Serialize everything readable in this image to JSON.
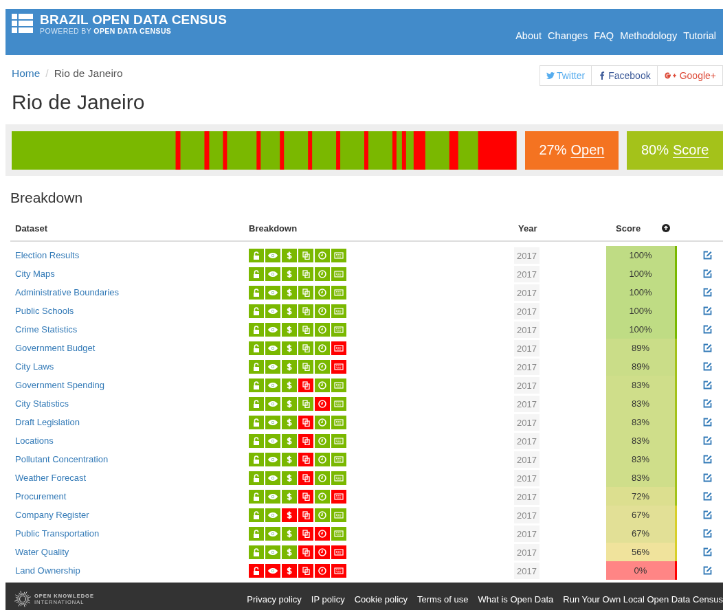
{
  "header": {
    "title": "BRAZIL OPEN DATA CENSUS",
    "subtitle_prefix": "POWERED BY",
    "subtitle_brand": "OPEN DATA CENSUS",
    "nav": [
      "About",
      "Changes",
      "FAQ",
      "Methodology",
      "Tutorial"
    ]
  },
  "breadcrumb": [
    {
      "label": "Home",
      "kind": "link"
    },
    {
      "label": "/",
      "kind": "separator"
    },
    {
      "label": "Rio de Janeiro",
      "kind": "current"
    }
  ],
  "share": [
    {
      "label": "Twitter",
      "kind": "twitter"
    },
    {
      "label": "Facebook",
      "kind": "facebook"
    },
    {
      "label": "Google+",
      "kind": "google"
    }
  ],
  "page_title": "Rio de Janeiro",
  "summary": [
    {
      "value": "27%",
      "label": "Open",
      "kind": "open"
    },
    {
      "value": "80%",
      "label": "Score",
      "kind": "score"
    }
  ],
  "section_title": "Breakdown",
  "table": {
    "columns": [
      "Dataset",
      "Breakdown",
      "Year",
      "Score"
    ],
    "rows": [
      {
        "name": "Election Results",
        "checks": [
          true,
          true,
          true,
          true,
          true,
          true
        ],
        "year": "2017",
        "score": "100%",
        "color": "#bfdc84"
      },
      {
        "name": "City Maps",
        "checks": [
          true,
          true,
          true,
          true,
          true,
          true
        ],
        "year": "2017",
        "score": "100%",
        "color": "#bfdc84"
      },
      {
        "name": "Administrative Boundaries",
        "checks": [
          true,
          true,
          true,
          true,
          true,
          true
        ],
        "year": "2017",
        "score": "100%",
        "color": "#bfdc84"
      },
      {
        "name": "Public Schools",
        "checks": [
          true,
          true,
          true,
          true,
          true,
          true
        ],
        "year": "2017",
        "score": "100%",
        "color": "#bfdc84"
      },
      {
        "name": "Crime Statistics",
        "checks": [
          true,
          true,
          true,
          true,
          true,
          true
        ],
        "year": "2017",
        "score": "100%",
        "color": "#bfdc84"
      },
      {
        "name": "Government Budget",
        "checks": [
          true,
          true,
          true,
          true,
          true,
          false
        ],
        "year": "2017",
        "score": "89%",
        "color": "#cadd88"
      },
      {
        "name": "City Laws",
        "checks": [
          true,
          true,
          true,
          true,
          true,
          false
        ],
        "year": "2017",
        "score": "89%",
        "color": "#cadd88"
      },
      {
        "name": "Government Spending",
        "checks": [
          true,
          true,
          true,
          false,
          true,
          true
        ],
        "year": "2017",
        "score": "83%",
        "color": "#cfde8a"
      },
      {
        "name": "City Statistics",
        "checks": [
          true,
          true,
          true,
          true,
          false,
          true
        ],
        "year": "2017",
        "score": "83%",
        "color": "#cfde8a"
      },
      {
        "name": "Draft Legislation",
        "checks": [
          true,
          true,
          true,
          false,
          true,
          true
        ],
        "year": "2017",
        "score": "83%",
        "color": "#cfde8a"
      },
      {
        "name": "Locations",
        "checks": [
          true,
          true,
          true,
          false,
          true,
          true
        ],
        "year": "2017",
        "score": "83%",
        "color": "#cfde8a"
      },
      {
        "name": "Pollutant Concentration",
        "checks": [
          true,
          true,
          true,
          false,
          true,
          true
        ],
        "year": "2017",
        "score": "83%",
        "color": "#cfde8a"
      },
      {
        "name": "Weather Forecast",
        "checks": [
          true,
          true,
          true,
          false,
          true,
          true
        ],
        "year": "2017",
        "score": "83%",
        "color": "#cfde8a"
      },
      {
        "name": "Procurement",
        "checks": [
          true,
          true,
          true,
          false,
          true,
          false
        ],
        "year": "2017",
        "score": "72%",
        "color": "#dcdf8f"
      },
      {
        "name": "Company Register",
        "checks": [
          true,
          true,
          false,
          false,
          true,
          true
        ],
        "year": "2017",
        "score": "67%",
        "color": "#e2e096"
      },
      {
        "name": "Public Transportation",
        "checks": [
          true,
          true,
          true,
          false,
          false,
          true
        ],
        "year": "2017",
        "score": "67%",
        "color": "#e2e096"
      },
      {
        "name": "Water Quality",
        "checks": [
          true,
          true,
          true,
          false,
          false,
          false
        ],
        "year": "2017",
        "score": "56%",
        "color": "#f0e39c"
      },
      {
        "name": "Land Ownership",
        "checks": [
          false,
          false,
          false,
          false,
          false,
          false
        ],
        "year": "2017",
        "score": "0%",
        "color": "#ff8585"
      }
    ]
  },
  "footer": {
    "logo_line1": "OPEN KNOWLEDGE",
    "logo_line2": "INTERNATIONAL",
    "links": [
      "Privacy policy",
      "IP policy",
      "Cookie policy",
      "Terms of use",
      "What is Open Data",
      "Run Your Own Local Open Data Census"
    ]
  }
}
